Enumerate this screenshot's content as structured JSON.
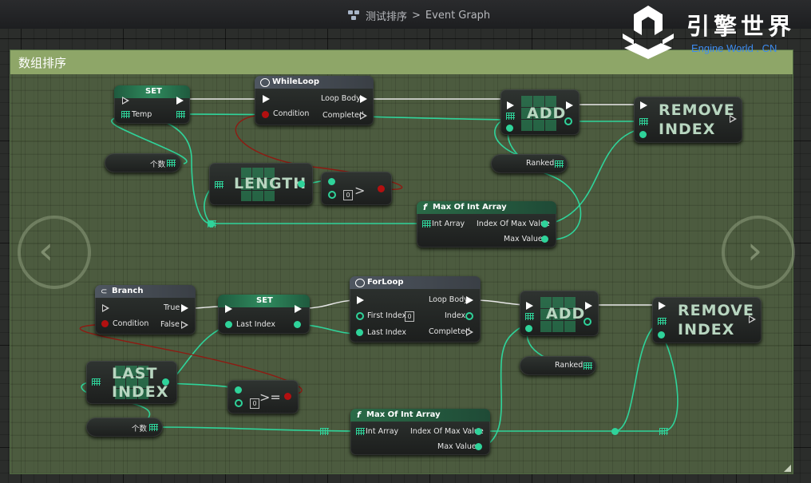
{
  "header": {
    "blueprint_name": "测试排序",
    "separator": ">",
    "graph_name": "Event Graph"
  },
  "logo": {
    "cn": "引擎世界",
    "en": "Engine World . CN"
  },
  "comment": {
    "title": "数组排序"
  },
  "nodes": {
    "set1": {
      "title": "SET",
      "var": "Temp"
    },
    "whileloop": {
      "title": "WhileLoop",
      "condition": "Condition",
      "loop_body": "Loop Body",
      "completed": "Completed"
    },
    "add1": {
      "title": "ADD"
    },
    "remove1": {
      "line1": "REMOVE",
      "line2": "INDEX"
    },
    "getcount1": {
      "label": "个数"
    },
    "ranked1": {
      "label": "Ranked"
    },
    "length": {
      "title": "LENGTH"
    },
    "greater": {
      "op": ">",
      "value": "0"
    },
    "maxint1": {
      "title": "Max Of Int Array",
      "in": "Int Array",
      "out1": "Index Of Max Value",
      "out2": "Max Value"
    },
    "branch": {
      "title": "Branch",
      "condition": "Condition",
      "true": "True",
      "false": "False"
    },
    "set2": {
      "title": "SET",
      "var": "Last Index"
    },
    "forloop": {
      "title": "ForLoop",
      "first": "First Index",
      "first_value": "0",
      "last": "Last Index",
      "loop_body": "Loop Body",
      "index": "Index",
      "completed": "Completed"
    },
    "add2": {
      "title": "ADD"
    },
    "remove2": {
      "line1": "REMOVE",
      "line2": "INDEX"
    },
    "ranked2": {
      "label": "Ranked"
    },
    "lastindex": {
      "line1": "LAST",
      "line2": "INDEX"
    },
    "gte": {
      "op": ">=",
      "value": "0"
    },
    "getcount2": {
      "label": "个数"
    },
    "maxint2": {
      "title": "Max Of Int Array",
      "in": "Int Array",
      "out1": "Index Of Max Value",
      "out2": "Max Value"
    }
  },
  "colors": {
    "pin_int": "#2fd39a",
    "pin_bool": "#b31010",
    "exec": "#ffffff",
    "comment_header": "#8ea668"
  }
}
